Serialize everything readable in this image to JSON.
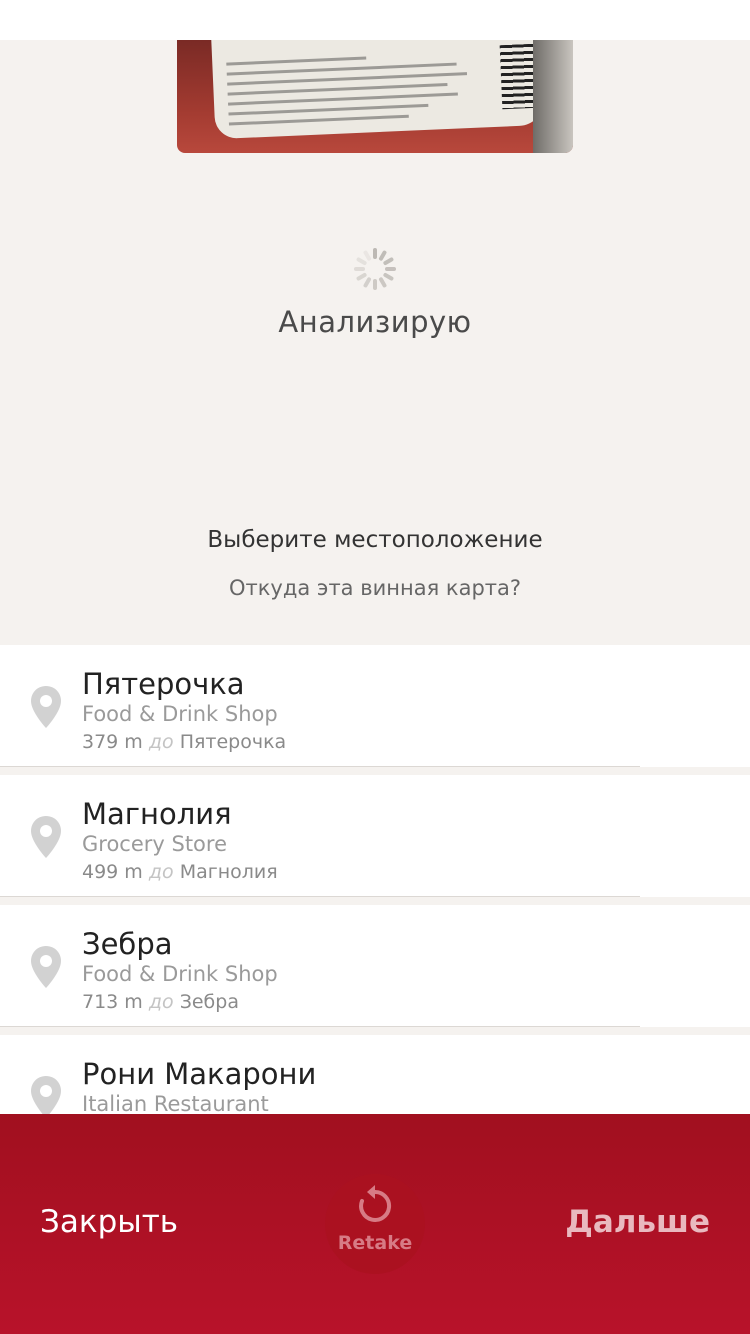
{
  "status": {
    "title": "Анализирую"
  },
  "prompt": {
    "title": "Выберите местоположение",
    "subtitle": "Откуда эта винная карта?"
  },
  "locations": [
    {
      "name": "Пятерочка",
      "category": "Food & Drink Shop",
      "distance": "379 m",
      "preposition": "до",
      "target": "Пятерочка"
    },
    {
      "name": "Магнолия",
      "category": "Grocery Store",
      "distance": "499 m",
      "preposition": "до",
      "target": "Магнолия"
    },
    {
      "name": "Зебра",
      "category": "Food & Drink Shop",
      "distance": "713 m",
      "preposition": "до",
      "target": "Зебра"
    },
    {
      "name": "Рони Макарони",
      "category": "Italian Restaurant",
      "distance": "",
      "preposition": "",
      "target": ""
    }
  ],
  "bottom_bar": {
    "close_label": "Закрыть",
    "retake_label": "Retake",
    "next_label": "Дальше"
  },
  "colors": {
    "accent": "#b8122a",
    "background": "#f5f2ef"
  },
  "icons": {
    "location": "map-pin-icon",
    "retake": "rotate-ccw-icon",
    "loading": "spinner-icon"
  }
}
